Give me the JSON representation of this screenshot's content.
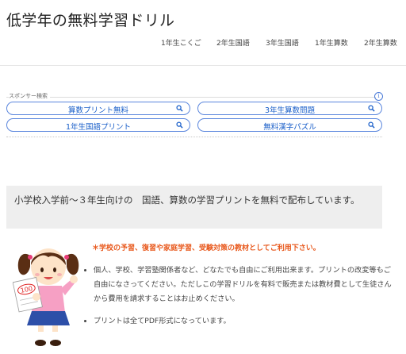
{
  "header": {
    "site_title": "低学年の無料学習ドリル",
    "nav": [
      {
        "label": "1年生こくご"
      },
      {
        "label": "2年生国語"
      },
      {
        "label": "3年生国語"
      },
      {
        "label": "1年生算数"
      },
      {
        "label": "2年生算数"
      }
    ]
  },
  "sponsor": {
    "label": "スポンサー検索",
    "info_icon": "info-icon",
    "links": [
      {
        "label": "算数プリント無料"
      },
      {
        "label": "3年生算数問題"
      },
      {
        "label": "1年生国語プリント"
      },
      {
        "label": "無料漢字パズル"
      }
    ]
  },
  "intro": {
    "text": "小学校入学前～３年生向けの　国語、算数の学習プリントを無料で配布しています。"
  },
  "notice": {
    "text": "＊学校の予習、復習や家庭学習、受験対策の教材としてご利用下さい。",
    "color": "#e8581c"
  },
  "bullets": [
    {
      "text": "個人、学校、学習塾関係者など、どなたでも自由にご利用出来ます。プリントの改変等もご自由になさってください。ただしこの学習ドリルを有料で販売または教材費として生徒さんから費用を請求することはお止めください。"
    },
    {
      "text": "プリントは全てPDF形式になっています。"
    }
  ],
  "illustration": {
    "paper_text": "100"
  },
  "colors": {
    "link_blue": "#1a5fc9",
    "pill_border": "#5a86dd",
    "intro_bg": "#eeeeee"
  }
}
